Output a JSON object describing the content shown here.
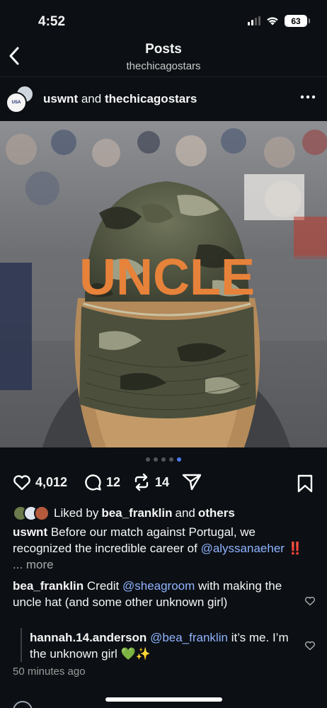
{
  "status": {
    "time": "4:52",
    "battery": "63"
  },
  "nav": {
    "title": "Posts",
    "subtitle": "thechicagostars"
  },
  "post": {
    "author_primary": "uswnt",
    "joiner": "and",
    "author_secondary": "thechicagostars",
    "avatar_badge_text": "USA",
    "image_text": "UNCLE",
    "carousel_count": 5,
    "carousel_active": 5
  },
  "actions": {
    "likes": "4,012",
    "comments": "12",
    "reposts": "14"
  },
  "liked": {
    "prefix": "Liked by",
    "user": "bea_franklin",
    "joiner": "and",
    "others": "others"
  },
  "caption": {
    "user": "uswnt",
    "text": "Before our match against Portugal, we recognized the incredible career of",
    "mention": "@alyssanaeher",
    "emoji": "‼️",
    "more": "... more"
  },
  "comments": [
    {
      "user": "bea_franklin",
      "pre": "Credit",
      "mention": "@sheagroom",
      "text": "with making the uncle hat (and some other unknown girl)"
    },
    {
      "user": "hannah.14.anderson",
      "mention": "@bea_franklin",
      "text": "it’s me. I’m the unknown girl",
      "emoji": "💚✨"
    }
  ],
  "timestamp": "50 minutes ago",
  "colors": {
    "background": "#0c1014",
    "mention": "#8fb2ff",
    "active_dot": "#4c7bf3",
    "hat_text": "#e7823a"
  },
  "icons": [
    "chevron-left-icon",
    "more-icon",
    "heart-icon",
    "comment-icon",
    "repost-icon",
    "share-icon",
    "bookmark-icon"
  ]
}
